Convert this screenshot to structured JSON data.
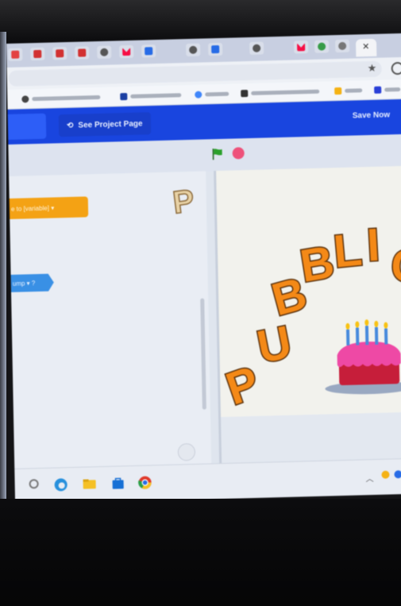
{
  "editor_header": {
    "see_project_label": "See Project Page",
    "save_label": "Save Now"
  },
  "code_blocks": {
    "orange_block_text": "e to  [variable]  ▾",
    "blue_block_text": "ump ▾   ?"
  },
  "stage": {
    "letters": [
      "P",
      "U",
      "B",
      "B",
      "L",
      "I",
      "C"
    ],
    "sprite_thumb_letter": "P"
  },
  "colors": {
    "editor_header": "#1b45d8",
    "letter_fill": "#f08a1d",
    "cake_frosting": "#e84ba3",
    "flag": "#2e9e2e",
    "stop": "#e8537a"
  },
  "icons": {
    "tabs": [
      "tab-favicon",
      "tab-favicon",
      "tab-favicon",
      "tab-favicon",
      "tab-favicon",
      "gmail-icon",
      "docs-icon",
      "tab-favicon",
      "docs-icon",
      "tab-favicon",
      "gmail-icon",
      "chrome-icon",
      "tab-favicon"
    ],
    "taskbar": [
      "edge-icon",
      "file-explorer-icon",
      "store-icon",
      "chrome-icon"
    ]
  }
}
